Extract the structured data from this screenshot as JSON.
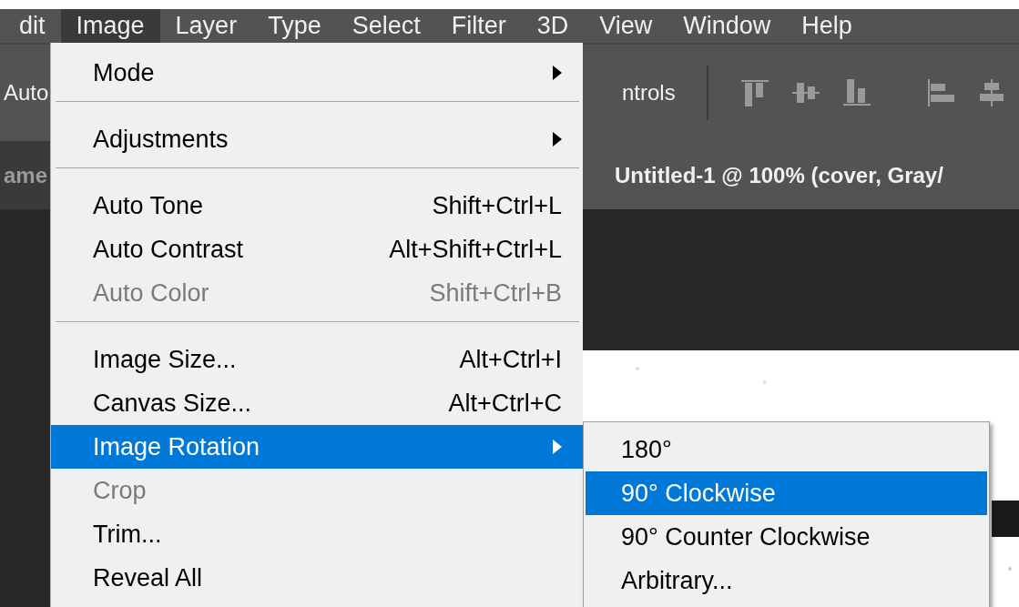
{
  "menubar": [
    {
      "label": "dit",
      "selected": false
    },
    {
      "label": "Image",
      "selected": true
    },
    {
      "label": "Layer",
      "selected": false
    },
    {
      "label": "Type",
      "selected": false
    },
    {
      "label": "Select",
      "selected": false
    },
    {
      "label": "Filter",
      "selected": false
    },
    {
      "label": "3D",
      "selected": false
    },
    {
      "label": "View",
      "selected": false
    },
    {
      "label": "Window",
      "selected": false
    },
    {
      "label": "Help",
      "selected": false
    }
  ],
  "options_bar": {
    "left_text": "Auto",
    "right_text": "ntrols"
  },
  "document_tabs": [
    {
      "label": "ame",
      "selected": false
    },
    {
      "label": "Untitled-1 @ 100% (cover, Gray/",
      "selected": true
    }
  ],
  "menu": [
    {
      "kind": "item",
      "label": "Mode",
      "has_submenu": true,
      "disabled": false,
      "selected": false
    },
    {
      "kind": "separator"
    },
    {
      "kind": "item",
      "label": "Adjustments",
      "has_submenu": true,
      "disabled": false,
      "selected": false
    },
    {
      "kind": "separator"
    },
    {
      "kind": "item",
      "label": "Auto Tone",
      "shortcut": "Shift+Ctrl+L",
      "has_submenu": false,
      "disabled": false,
      "selected": false
    },
    {
      "kind": "item",
      "label": "Auto Contrast",
      "shortcut": "Alt+Shift+Ctrl+L",
      "has_submenu": false,
      "disabled": false,
      "selected": false
    },
    {
      "kind": "item",
      "label": "Auto Color",
      "shortcut": "Shift+Ctrl+B",
      "has_submenu": false,
      "disabled": true,
      "selected": false
    },
    {
      "kind": "separator"
    },
    {
      "kind": "item",
      "label": "Image Size...",
      "shortcut": "Alt+Ctrl+I",
      "has_submenu": false,
      "disabled": false,
      "selected": false
    },
    {
      "kind": "item",
      "label": "Canvas Size...",
      "shortcut": "Alt+Ctrl+C",
      "has_submenu": false,
      "disabled": false,
      "selected": false
    },
    {
      "kind": "item",
      "label": "Image Rotation",
      "has_submenu": true,
      "disabled": false,
      "selected": true
    },
    {
      "kind": "item",
      "label": "Crop",
      "has_submenu": false,
      "disabled": true,
      "selected": false
    },
    {
      "kind": "item",
      "label": "Trim...",
      "has_submenu": false,
      "disabled": false,
      "selected": false
    },
    {
      "kind": "item",
      "label": "Reveal All",
      "has_submenu": false,
      "disabled": false,
      "selected": false
    }
  ],
  "submenu": [
    {
      "label": "180°",
      "selected": false
    },
    {
      "label": "90° Clockwise",
      "selected": true
    },
    {
      "label": "90° Counter Clockwise",
      "selected": false
    },
    {
      "label": "Arbitrary...",
      "selected": false
    }
  ]
}
